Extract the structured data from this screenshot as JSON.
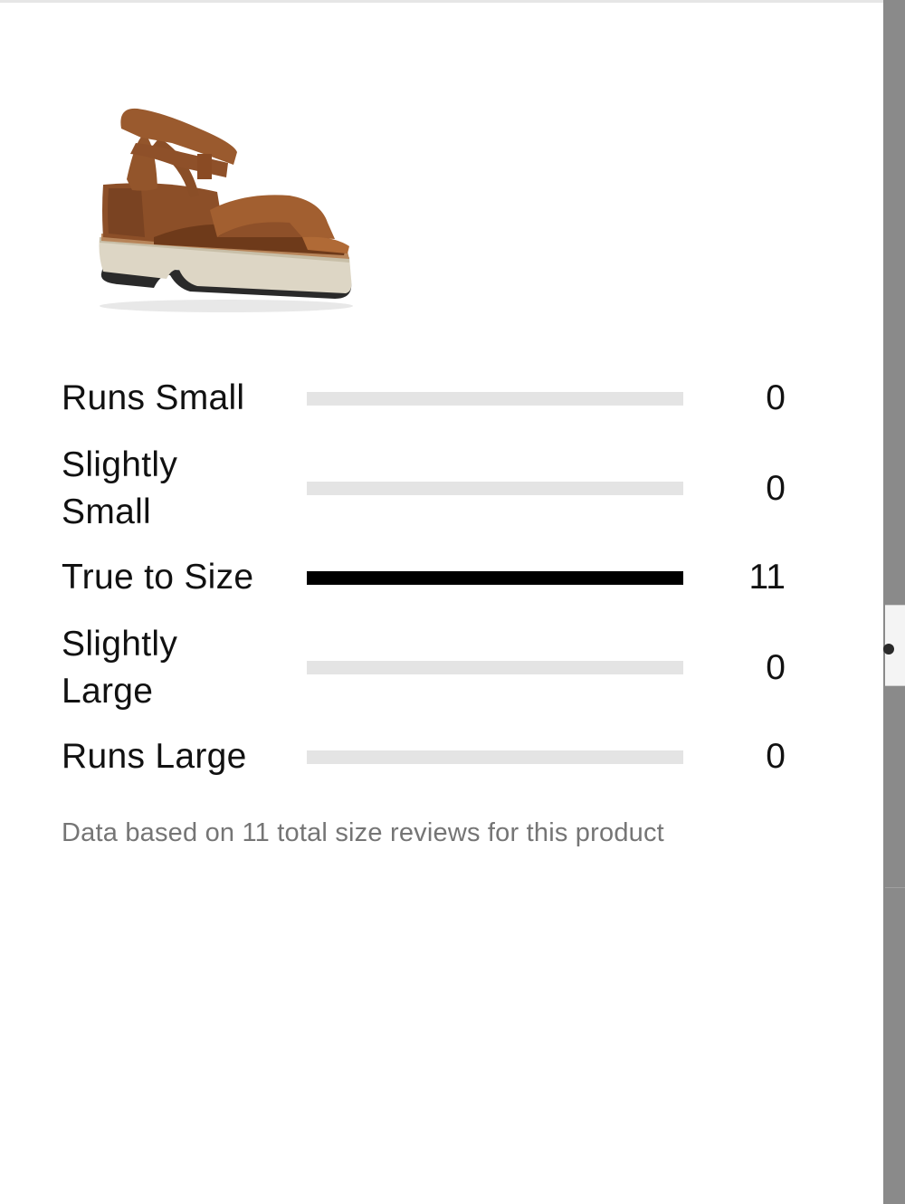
{
  "product": {
    "image_alt": "Brown leather platform sandal with ankle strap"
  },
  "size_fit": {
    "rows": [
      {
        "label_line1": "Runs Small",
        "label_line2": "",
        "count": "0",
        "fraction": 0
      },
      {
        "label_line1": "Slightly",
        "label_line2": "Small",
        "count": "0",
        "fraction": 0
      },
      {
        "label_line1": "True to Size",
        "label_line2": "",
        "count": "11",
        "fraction": 1
      },
      {
        "label_line1": "Slightly",
        "label_line2": "Large",
        "count": "0",
        "fraction": 0
      },
      {
        "label_line1": "Runs Large",
        "label_line2": "",
        "count": "0",
        "fraction": 0
      }
    ],
    "footnote": "Data based on 11 total size reviews for this product"
  },
  "colors": {
    "bar_fill": "#000000",
    "bar_track": "#e4e4e4",
    "footnote_text": "#757575"
  }
}
